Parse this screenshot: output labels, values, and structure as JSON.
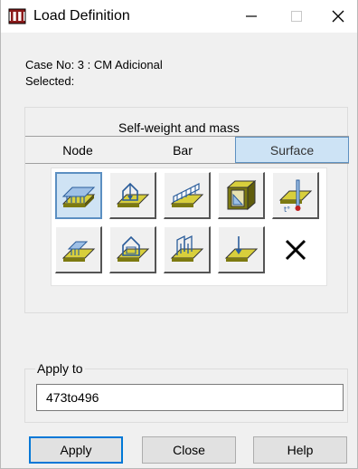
{
  "window": {
    "title": "Load Definition",
    "icon": "load-frame-icon",
    "controls": [
      "minimize-icon",
      "maximize-icon",
      "close-icon"
    ]
  },
  "info": {
    "case_line": "Case No: 3 : CM Adicional",
    "selected_line": "Selected:"
  },
  "load_types": {
    "group_label": "Self-weight and mass",
    "tabs": [
      {
        "label": "Node",
        "active": false
      },
      {
        "label": "Bar",
        "active": false
      },
      {
        "label": "Surface",
        "active": true
      }
    ]
  },
  "palette": {
    "tools": [
      {
        "icon": "uniform-planar-load-icon",
        "selected": true
      },
      {
        "icon": "point-load-on-surface-icon",
        "selected": false
      },
      {
        "icon": "linear-load-on-edge-icon",
        "selected": false
      },
      {
        "icon": "hydrostatic-pressure-icon",
        "selected": false
      },
      {
        "icon": "thermal-load-icon",
        "selected": false
      },
      {
        "icon": "planar-load-on-contour-icon",
        "selected": false
      },
      {
        "icon": "point-load-on-contour-icon",
        "selected": false
      },
      {
        "icon": "linear-load-on-contour-icon",
        "selected": false
      },
      {
        "icon": "self-weight-icon",
        "selected": false
      },
      {
        "icon": "delete-load-icon",
        "selected": false
      }
    ]
  },
  "apply_to": {
    "label": "Apply to",
    "value": "473to496"
  },
  "buttons": {
    "apply": "Apply",
    "close": "Close",
    "help": "Help"
  },
  "colors": {
    "accent_blue": "#5b8fc2",
    "selected_fill": "#cfe3f4",
    "plate_yellow": "#d8cf3c",
    "plate_olive": "#7d7a10"
  }
}
